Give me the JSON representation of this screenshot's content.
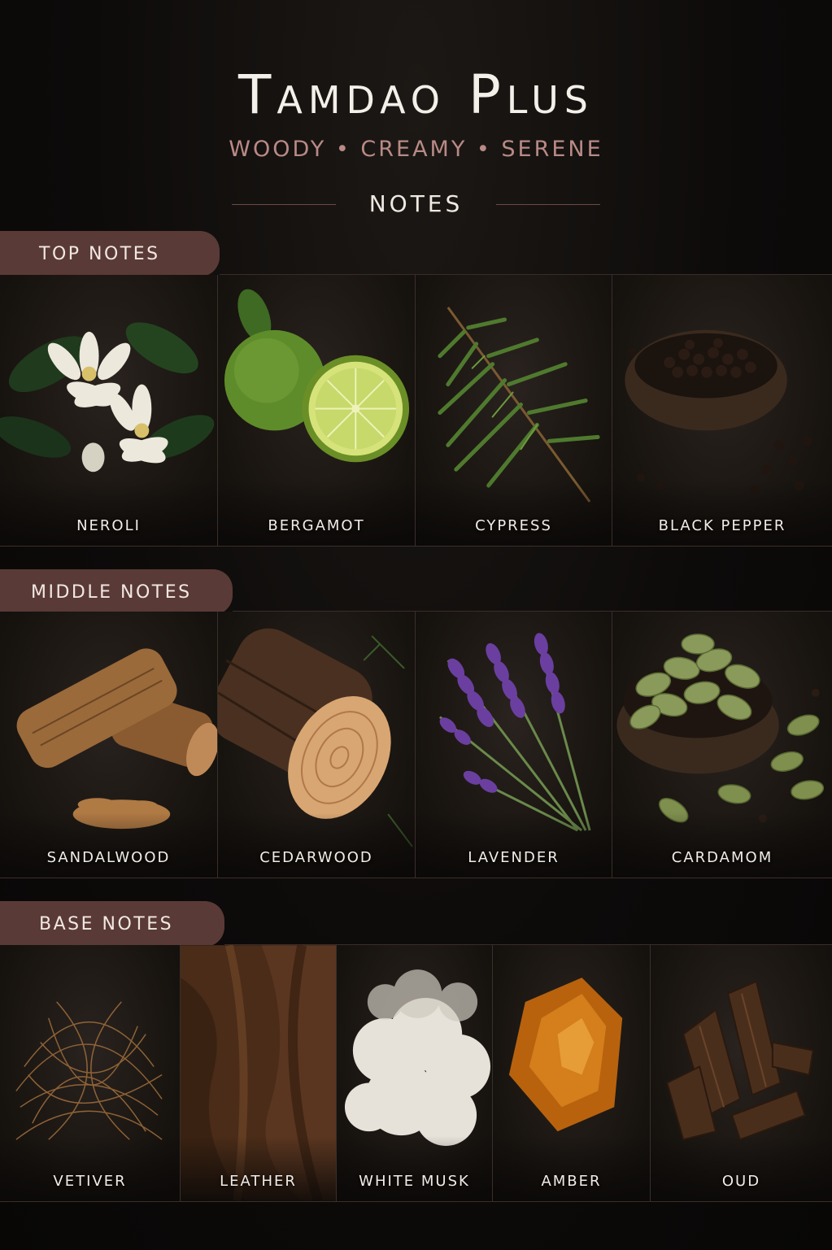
{
  "header": {
    "title": "Tamdao Plus",
    "tagline": "WOODY • CREAMY • SERENE",
    "section": "NOTES"
  },
  "tiers": {
    "top": {
      "label": "TOP NOTES",
      "items": [
        "NEROLI",
        "BERGAMOT",
        "CYPRESS",
        "BLACK PEPPER"
      ]
    },
    "middle": {
      "label": "MIDDLE NOTES",
      "items": [
        "SANDALWOOD",
        "CEDARWOOD",
        "LAVENDER",
        "CARDAMOM"
      ]
    },
    "base": {
      "label": "BASE NOTES",
      "items": [
        "VETIVER",
        "LEATHER",
        "WHITE MUSK",
        "AMBER",
        "OUD"
      ]
    }
  },
  "colors": {
    "accent": "#5a3a36",
    "tagline": "#b98a86",
    "background": "#0c0a09"
  }
}
